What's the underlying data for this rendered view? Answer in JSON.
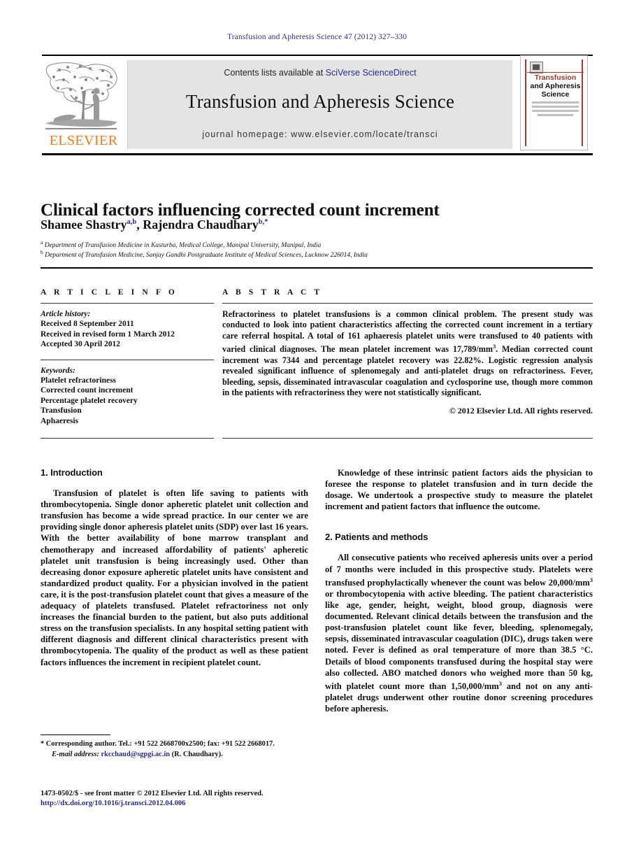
{
  "running_head": "Transfusion and Apheresis Science 47 (2012) 327–330",
  "masthead": {
    "elsevier_wordmark": "ELSEVIER",
    "contents_prefix": "Contents lists available at ",
    "contents_link": "SciVerse ScienceDirect",
    "journal_title": "Transfusion and Apheresis Science",
    "homepage": "journal homepage: www.elsevier.com/locate/transci",
    "cover": {
      "line1": "Transfusion",
      "line2": "and Apheresis",
      "line3": "Science"
    }
  },
  "article": {
    "title": "Clinical factors influencing corrected count increment",
    "authors_html": "Shamee Shastry, Rajendra Chaudhary",
    "author1": "Shamee Shastry",
    "author1_sup": "a,b",
    "author2": "Rajendra Chaudhary",
    "author2_sup": "b,*",
    "affiliation_a_sup": "a",
    "affiliation_a": "Department of Transfusion Medicine in Kasturba, Medical College, Manipal University, Manipal, India",
    "affiliation_b_sup": "b",
    "affiliation_b": "Department of Transfusion Medicine, Sanjay Gandhi Postgraduate Institute of Medical Sciences, Lucknow 226014, India"
  },
  "article_info": {
    "heading": "A R T I C L E   I N F O",
    "history_label": "Article history:",
    "history": [
      "Received 8 September 2011",
      "Received in revised form 1 March 2012",
      "Accepted 30 April 2012"
    ],
    "keywords_label": "Keywords:",
    "keywords": [
      "Platelet refractoriness",
      "Corrected count increment",
      "Percentage platelet recovery",
      "Transfusion",
      "Aphaeresis"
    ]
  },
  "abstract": {
    "heading": "A B S T R A C T",
    "text_part1": "Refractoriness to platelet transfusions is a common clinical problem. The present study was conducted to look into patient characteristics affecting the corrected count increment in a tertiary care referral hospital. A total of 161 aphaeresis platelet units were transfused to 40 patients with varied clinical diagnoses. The mean platelet increment was 17,789/mm",
    "sup1": "3",
    "text_part2": ". Median corrected count increment was 7344 and percentage platelet recovery was 22.82%. Logistic regression analysis revealed significant influence of splenomegaly and anti-platelet drugs on refractoriness. Fever, bleeding, sepsis, disseminated intravascular coagulation and cyclosporine use, though more common in the patients with refractoriness they were not statistically significant.",
    "copyright": "© 2012 Elsevier Ltd. All rights reserved."
  },
  "body": {
    "section1_heading": "1. Introduction",
    "section1_para1": "Transfusion of platelet is often life saving to patients with thrombocytopenia. Single donor apheretic platelet unit collection and transfusion has become a wide spread practice. In our center we are providing single donor apheresis platelet units (SDP) over last 16 years. With the better availability of bone marrow transplant and chemotherapy and increased affordability of patients' apheretic platelet unit transfusion is being increasingly used. Other than decreasing donor exposure apheretic platelet units have consistent and standardized product quality. For a physician involved in the patient care, it is the post-transfusion platelet count that gives a measure of the adequacy of platelets transfused. Platelet refractoriness not only increases the financial burden to the patient, but also puts additional stress on the transfusion specialists. In any hospital setting patient with different diagnosis and different clinical characteristics present with thrombocytopenia. The quality of the product as well as these patient factors influences the increment in recipient platelet count.",
    "section1_para2": "Knowledge of these intrinsic patient factors aids the physician to foresee the response to platelet transfusion and in turn decide the dosage. We undertook a prospective study to measure the platelet increment and patient factors that influence the outcome.",
    "section2_heading": "2. Patients and methods",
    "section2_para1_a": "All consecutive patients who received apheresis units over a period of 7 months were included in this prospective study. Platelets were transfused prophylactically whenever the count was below 20,000/mm",
    "section2_sup1": "3",
    "section2_para1_b": " or thrombocytopenia with active bleeding. The patient characteristics like age, gender, height, weight, blood group, diagnosis were documented. Relevant clinical details between the transfusion and the post-transfusion platelet count like fever, bleeding, splenomegaly, sepsis, disseminated intravascular coagulation (DIC), drugs taken were noted. Fever is defined as oral temperature of more than 38.5 °C. Details of blood components transfused during the hospital stay were also collected. ABO matched donors who weighed more than 50 kg, with platelet count more than 1,50,000/mm",
    "section2_sup2": "3",
    "section2_para1_c": " and not on any anti-platelet drugs underwent other routine donor screening procedures before apheresis."
  },
  "footnote": {
    "corresponding": "* Corresponding author. Tel.: +91 522 2668700x2500; fax: +91 522 2668017.",
    "email_label": "E-mail address:",
    "email": "rkcchaud@sgpgi.ac.in",
    "email_owner": "(R. Chaudhary)."
  },
  "page_footer": {
    "issn_line": "1473-0502/$ - see front matter © 2012 Elsevier Ltd. All rights reserved.",
    "doi": "http://dx.doi.org/10.1016/j.transci.2012.04.006"
  },
  "colors": {
    "running_head": "#33338f",
    "link": "#2c2c8c",
    "elsevier_orange": "#f07d1a",
    "band_gray": "#e4e4e4",
    "cover_red": "#9c3b2e"
  }
}
